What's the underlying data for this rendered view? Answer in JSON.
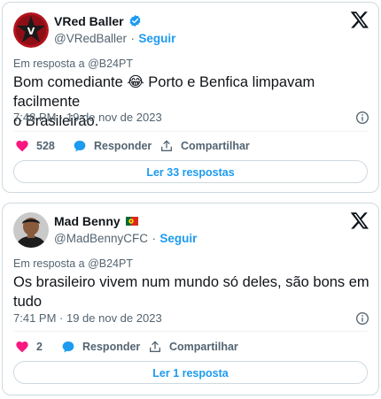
{
  "tweets": [
    {
      "author_name": "VRed Baller",
      "handle": "@VRedBaller",
      "separator": "·",
      "follow_label": "Seguir",
      "reply_to": "Em resposta a @B24PT",
      "text_line1": "Bom comediante 😂 Porto e Benfica limpavam facilmente",
      "text_line2": "o Brasileirão.",
      "timestamp": "7:48 PM · 19 de nov de 2023",
      "likes": "528",
      "reply_label": "Responder",
      "share_label": "Compartilhar",
      "more_replies_label": "Ler 33 respostas"
    },
    {
      "author_name": "Mad Benny",
      "handle": "@MadBennyCFC",
      "separator": "·",
      "follow_label": "Seguir",
      "reply_to": "Em resposta a @B24PT",
      "text_line1": "Os brasileiro vivem num mundo só deles, são bons em",
      "text_line2": "tudo",
      "timestamp": "7:41 PM · 19 de nov de 2023",
      "likes": "2",
      "reply_label": "Responder",
      "share_label": "Compartilhar",
      "more_replies_label": "Ler 1 resposta"
    }
  ],
  "colors": {
    "accent": "#1d9bf0",
    "like": "#f91880",
    "secondary_text": "#536471",
    "border": "#cfd9de"
  },
  "icons": [
    "verified-badge-icon",
    "x-logo-icon",
    "info-icon",
    "heart-icon",
    "reply-bubble-icon",
    "share-icon",
    "portugal-flag-icon"
  ]
}
